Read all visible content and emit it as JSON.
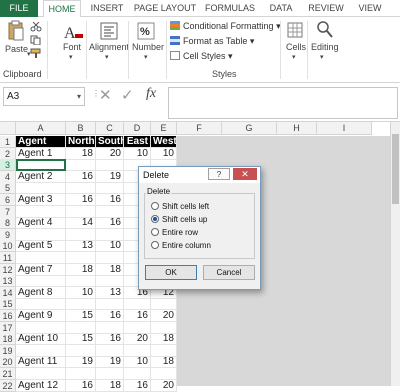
{
  "tabs": [
    "FILE",
    "HOME",
    "INSERT",
    "PAGE LAYOUT",
    "FORMULAS",
    "DATA",
    "REVIEW",
    "VIEW"
  ],
  "ribbon": {
    "paste": "Paste",
    "clipboard": "Clipboard",
    "font": "Font",
    "alignment": "Alignment",
    "number": "Number",
    "conditional_formatting": "Conditional Formatting",
    "format_as_table": "Format as Table",
    "cell_styles": "Cell Styles",
    "styles": "Styles",
    "cells": "Cells",
    "editing": "Editing",
    "percent_symbol": "%"
  },
  "formula_bar": {
    "name_box": "A3",
    "fx": "fx",
    "formula": ""
  },
  "columns": [
    "A",
    "B",
    "C",
    "D",
    "E",
    "F",
    "G",
    "H",
    "I"
  ],
  "rows": [
    {
      "n": "1",
      "cells": [
        "Agent",
        "North",
        "South",
        "East",
        "West"
      ],
      "header": true
    },
    {
      "n": "2",
      "cells": [
        "Agent  1",
        "18",
        "20",
        "10",
        "10"
      ]
    },
    {
      "n": "3",
      "cells": [
        "",
        "",
        "",
        "",
        ""
      ]
    },
    {
      "n": "4",
      "cells": [
        "Agent  2",
        "16",
        "19",
        "",
        ""
      ]
    },
    {
      "n": "5",
      "cells": [
        "",
        "",
        "",
        "",
        ""
      ]
    },
    {
      "n": "6",
      "cells": [
        "Agent  3",
        "16",
        "16",
        "",
        ""
      ]
    },
    {
      "n": "7",
      "cells": [
        "",
        "",
        "",
        "",
        ""
      ]
    },
    {
      "n": "8",
      "cells": [
        "Agent  4",
        "14",
        "16",
        "",
        ""
      ]
    },
    {
      "n": "9",
      "cells": [
        "",
        "",
        "",
        "",
        ""
      ]
    },
    {
      "n": "10",
      "cells": [
        "Agent  5",
        "13",
        "10",
        "",
        ""
      ]
    },
    {
      "n": "11",
      "cells": [
        "",
        "",
        "",
        "",
        ""
      ]
    },
    {
      "n": "12",
      "cells": [
        "Agent  7",
        "18",
        "18",
        "",
        ""
      ]
    },
    {
      "n": "13",
      "cells": [
        "",
        "",
        "",
        "",
        ""
      ]
    },
    {
      "n": "14",
      "cells": [
        "Agent  8",
        "10",
        "13",
        "16",
        "12"
      ]
    },
    {
      "n": "15",
      "cells": [
        "",
        "",
        "",
        "",
        ""
      ]
    },
    {
      "n": "16",
      "cells": [
        "Agent  9",
        "15",
        "16",
        "16",
        "20"
      ]
    },
    {
      "n": "17",
      "cells": [
        "",
        "",
        "",
        "",
        ""
      ]
    },
    {
      "n": "18",
      "cells": [
        "Agent  10",
        "15",
        "16",
        "20",
        "18"
      ]
    },
    {
      "n": "19",
      "cells": [
        "",
        "",
        "",
        "",
        ""
      ]
    },
    {
      "n": "20",
      "cells": [
        "Agent  11",
        "19",
        "19",
        "10",
        "18"
      ]
    },
    {
      "n": "21",
      "cells": [
        "",
        "",
        "",
        "",
        ""
      ]
    },
    {
      "n": "22",
      "cells": [
        "Agent  12",
        "16",
        "18",
        "16",
        "20"
      ]
    }
  ],
  "dialog": {
    "title": "Delete",
    "help": "?",
    "close": "✕",
    "group_label": "Delete",
    "options": [
      "Shift cells left",
      "Shift cells up",
      "Entire row",
      "Entire column"
    ],
    "selected_index": 1,
    "ok": "OK",
    "cancel": "Cancel"
  },
  "colors": {
    "accent": "#217346",
    "header_fill": "#000000"
  }
}
